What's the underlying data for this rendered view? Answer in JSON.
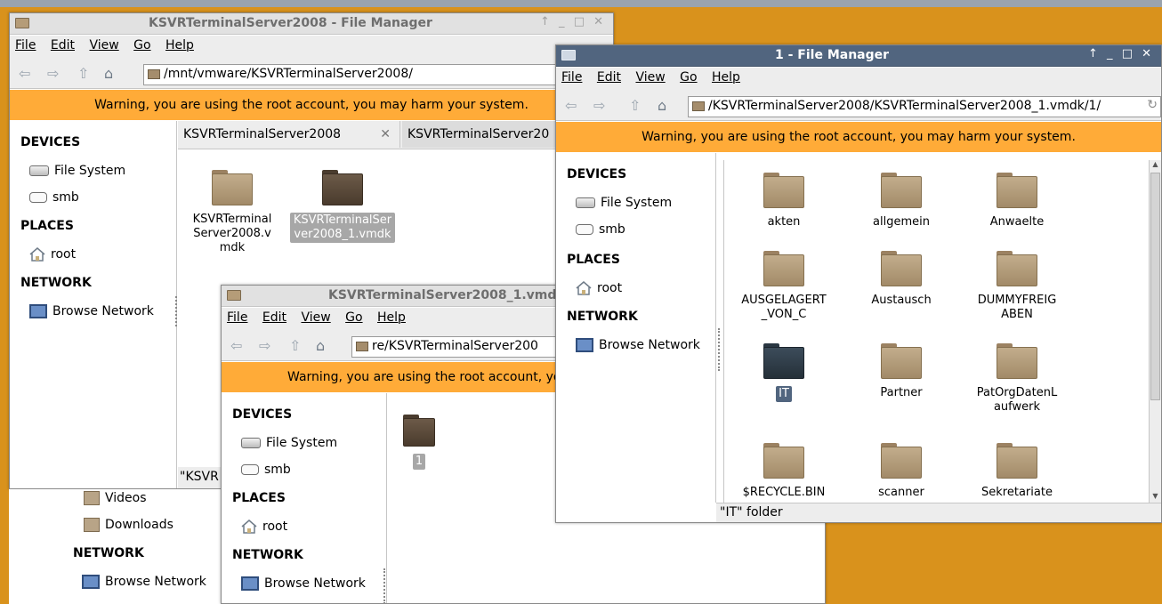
{
  "menu": {
    "file": "File",
    "edit": "Edit",
    "view": "View",
    "go": "Go",
    "help": "Help"
  },
  "warning": "Warning, you are using the root account, you may harm your system.",
  "sidebar": {
    "devices": "DEVICES",
    "file_system": "File System",
    "smb": "smb",
    "places": "PLACES",
    "root": "root",
    "network": "NETWORK",
    "browse_network": "Browse Network",
    "videos": "Videos",
    "downloads": "Downloads"
  },
  "win1": {
    "title": "KSVRTerminalServer2008 - File Manager",
    "address": "/mnt/vmware/KSVRTerminalServer2008/",
    "tabs": [
      "KSVRTerminalServer2008",
      "KSVRTerminalServer20"
    ],
    "items": [
      "KSVRTerminalServer2008.vmdk",
      "KSVRTerminalServer2008_1.vmdk"
    ],
    "status": "\"KSVR"
  },
  "win2": {
    "title": "KSVRTerminalServer2008_1.vmdk",
    "address": "re/KSVRTerminalServer200",
    "items": [
      "1"
    ]
  },
  "win3": {
    "title": "1 - File Manager",
    "address": "/KSVRTerminalServer2008/KSVRTerminalServer2008_1.vmdk/1/",
    "folders": [
      "akten",
      "allgemein",
      "Anwaelte",
      "AUSGELAGERT_VON_C",
      "Austausch",
      "DUMMYFREIGABEN",
      "IT",
      "Partner",
      "PatOrgDatenLaufwerk",
      "$RECYCLE.BIN",
      "scanner",
      "Sekretariate"
    ],
    "status": "\"IT\" folder"
  }
}
